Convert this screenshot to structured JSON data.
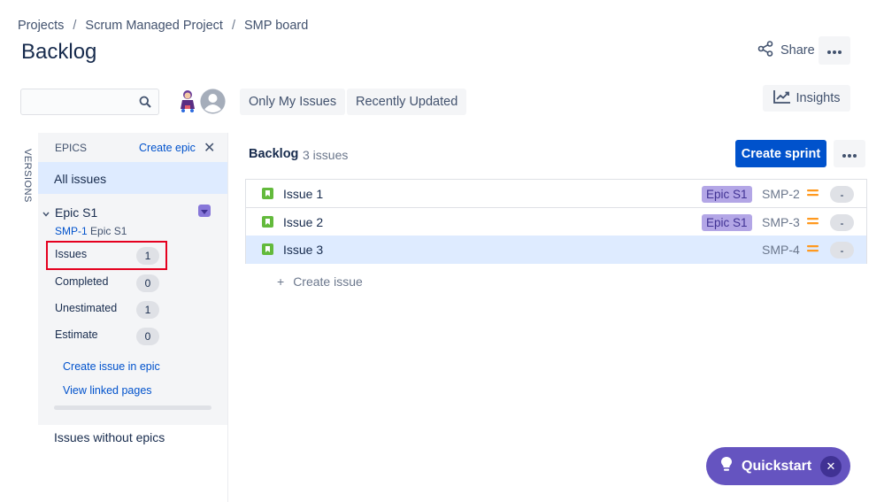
{
  "breadcrumb": [
    "Projects",
    "Scrum Managed Project",
    "SMP board"
  ],
  "breadcrumb_sep": "/",
  "page_title": "Backlog",
  "header": {
    "share_label": "Share",
    "more_label": "•••"
  },
  "toolbar": {
    "search_placeholder": "",
    "filters": [
      "Only My Issues",
      "Recently Updated"
    ],
    "insights_label": "Insights"
  },
  "versions_label": "VERSIONS",
  "epic_panel": {
    "header": "EPICS",
    "create_label": "Create epic",
    "close_label": "✕",
    "all_issues": "All issues",
    "epic": {
      "name": "Epic S1",
      "key": "SMP-1",
      "title": "Epic S1",
      "stats": [
        {
          "label": "Issues",
          "value": "1"
        },
        {
          "label": "Completed",
          "value": "0"
        },
        {
          "label": "Unestimated",
          "value": "1"
        },
        {
          "label": "Estimate",
          "value": "0"
        }
      ],
      "links": [
        "Create issue in epic",
        "View linked pages"
      ]
    },
    "issues_without_epics": "Issues without epics"
  },
  "backlog": {
    "label": "Backlog",
    "count": "3 issues",
    "create_sprint": "Create sprint",
    "more_label": "•••",
    "issues": [
      {
        "summary": "Issue 1",
        "epic": "Epic S1",
        "key": "SMP-2",
        "estimate": "-"
      },
      {
        "summary": "Issue 2",
        "epic": "Epic S1",
        "key": "SMP-3",
        "estimate": "-"
      },
      {
        "summary": "Issue 3",
        "epic": "",
        "key": "SMP-4",
        "estimate": "-"
      }
    ],
    "create_issue_plus": "+",
    "create_issue": "Create issue"
  },
  "quickstart": {
    "label": "Quickstart",
    "close": "✕"
  },
  "colors": {
    "primary": "#0052cc",
    "selected_bg": "#deebff",
    "epic_purple": "#8777d9",
    "story_green": "#63ba3c",
    "priority_orange": "#ff991f",
    "highlight_red": "#e5001f",
    "quickstart_purple": "#6554c0"
  }
}
